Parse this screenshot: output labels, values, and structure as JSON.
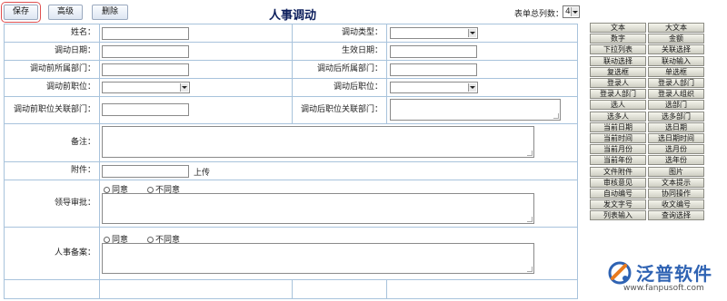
{
  "toolbar": {
    "save_label": "保存",
    "advanced_label": "高级",
    "delete_label": "删除",
    "title": "人事调动",
    "col_count_label": "表单总列数：",
    "col_count_value": "4"
  },
  "form": {
    "name_label": "姓名：",
    "transfer_type_label": "调动类型：",
    "transfer_date_label": "调动日期：",
    "effective_date_label": "生效日期：",
    "dept_before_label": "调动前所属部门：",
    "dept_after_label": "调动后所属部门：",
    "position_before_label": "调动前职位：",
    "position_after_label": "调动后职位：",
    "related_before_label": "调动前职位关联部门：",
    "related_after_label": "调动后职位关联部门：",
    "remark_label": "备注：",
    "attachment_label": "附件：",
    "upload_label": "上传",
    "leader_label": "领导审批：",
    "hr_label": "人事备案：",
    "agree_label": "同意",
    "disagree_label": "不同意"
  },
  "palette": {
    "buttons": [
      "文本",
      "大文本",
      "数字",
      "金额",
      "下拉列表",
      "关联选择",
      "联动选择",
      "联动输入",
      "复选框",
      "单选框",
      "登录人",
      "登录人部门",
      "登录人部门",
      "登录人组织",
      "选人",
      "选部门",
      "选多人",
      "选多部门",
      "当前日期",
      "选日期",
      "当前时间",
      "选日期时间",
      "当前月份",
      "选月份",
      "当前年份",
      "选年份",
      "文件附件",
      "图片",
      "审核意见",
      "文本提示",
      "自动编号",
      "协同操作",
      "发文字号",
      "收文编号",
      "列表输入",
      "查询选择"
    ]
  },
  "logo": {
    "text": "泛普软件",
    "url": "www.fanpusoft.com",
    "color": "#2f63b3"
  }
}
